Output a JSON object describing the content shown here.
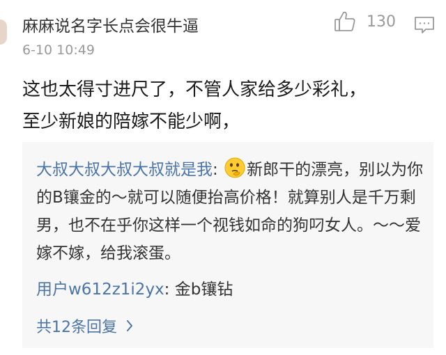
{
  "comment": {
    "username": "麻麻说名字长点会很牛逼",
    "timestamp": "6-10 10:49",
    "like_count": "130",
    "content": "这也太得寸进尺了，不管人家给多少彩礼，\n至少新娘的陪嫁不能少啊，"
  },
  "reply": {
    "author": "大叔大叔大叔大叔就是我",
    "separator": ":",
    "emoji": "thinking-face-icon",
    "text": "新郎干的漂亮，别以为你的B镶金的～就可以随便抬高价格！就算别人是千万剩男，也不在乎你这样一个视钱如命的狗叼女人。～～爱嫁不嫁，给我滚蛋。"
  },
  "sub_reply": {
    "author": "用户w612z1i2yx",
    "separator": ":",
    "text": "金b镶钻"
  },
  "total_replies": {
    "label": "共12条回复"
  },
  "colors": {
    "link_blue": "#4a74a8",
    "meta_gray": "#999999",
    "reply_bg": "#f7f7f7"
  },
  "icons": {
    "like": "thumbs-up-icon",
    "reply": "comment-bubble-icon",
    "more": "chevron-right-icon"
  }
}
